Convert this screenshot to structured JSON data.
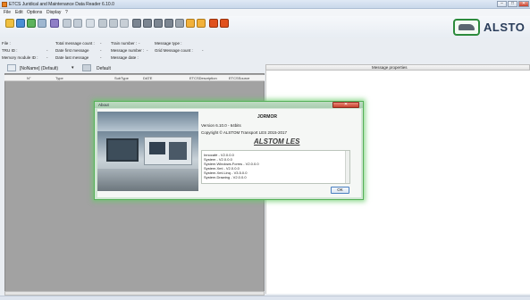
{
  "window": {
    "title": "ETCS Juridical and Maintenance Data Reader 6.10.0",
    "min_label": "–",
    "max_label": "□",
    "close_label": "✕"
  },
  "menu": [
    "File",
    "Edit",
    "Options",
    "Display",
    "?"
  ],
  "logo": {
    "text": "ALSTO",
    "color": "#2c8b3c"
  },
  "info": {
    "row1": {
      "file_label": "File :",
      "total_label": "Total message count :",
      "total_value": "-",
      "train_label": "Train number :",
      "train_value": "-",
      "msgtype_label": "Message type :"
    },
    "row2": {
      "tru_label": "TRU ID :",
      "tru_value": "-",
      "first_label": "Date first message",
      "first_value": "-",
      "msgnum_label": "Message number :",
      "msgnum_value": "-",
      "grid_label": "Grid Message count :",
      "grid_value": "-"
    },
    "row3": {
      "mem_label": "Memory module ID :",
      "mem_value": "-",
      "last_label": "Date last message",
      "last_value": "-",
      "msgdate_label": "Message date :"
    }
  },
  "filter": {
    "name": "[NoName] (Default)",
    "default_label": "Default"
  },
  "grid": {
    "columns": [
      "N°",
      "Type",
      "SubType",
      "DATE",
      "ETCSDescription",
      "ETCSSource"
    ]
  },
  "right_panel": {
    "header": "Message properties"
  },
  "about": {
    "title": "About",
    "product": "JORMOR",
    "version": "Version 6.10.0 - 64bits",
    "copyright": "Copyright © ALSTOM Transport LES 2015-2017",
    "company": "ALSTOM LES",
    "ok_label": "OK",
    "assemblies": [
      "Innocafé  -  V2.0.0.0",
      "System  -  V2.0.0.0",
      "System.Windows.Forms  -  V2.0.0.0",
      "System.Xml  -  V2.0.0.0",
      "System.Xml.Linq  -  V3.5.0.0",
      "System.Drawing  -  V2.0.0.0"
    ]
  },
  "colors": {
    "accent": "#2c8b3c",
    "dialog_glow": "#66cc66",
    "close_red": "#c8412d"
  }
}
